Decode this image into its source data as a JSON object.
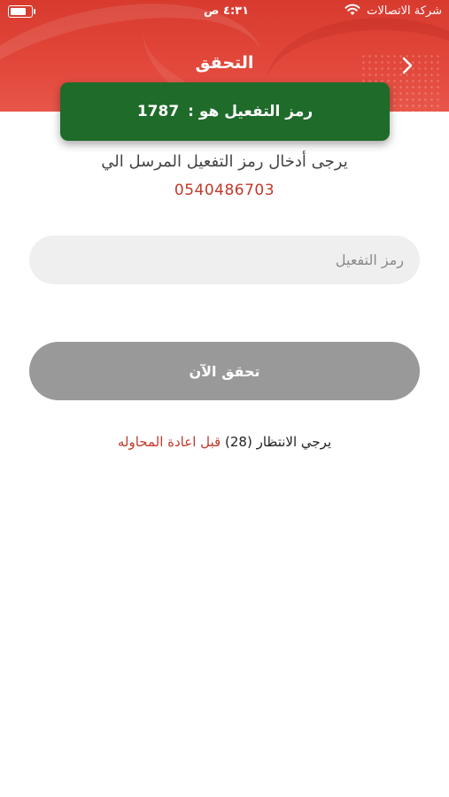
{
  "status_bar": {
    "carrier": "شركة الاتصالات",
    "time": "٤:٣١ ص",
    "battery_level": 0.85
  },
  "header": {
    "title": "التحقق",
    "back_icon": "chevron-right-icon"
  },
  "toast": {
    "label": "رمز التفعيل هو :",
    "code": "1787",
    "color": "#1f6b2a"
  },
  "instructions": {
    "text": "يرجى أدخال رمز التفعيل المرسل الي",
    "phone": "0540486703"
  },
  "code_input": {
    "placeholder": "رمز التفعيل",
    "value": ""
  },
  "verify_button": {
    "label": "تحقق الآن"
  },
  "resend": {
    "prefix": "يرجي الانتظار",
    "countdown": "(28)",
    "suffix": "قبل اعادة المحاوله"
  },
  "colors": {
    "header": "#e2483b",
    "accent": "#c0392b",
    "button": "#999999"
  }
}
